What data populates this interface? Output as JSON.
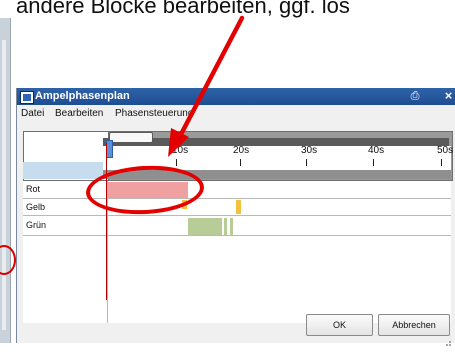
{
  "annotation": {
    "top_text": "andere Blöcke bearbeiten, ggf. lös"
  },
  "window": {
    "title": "Ampelphasenplan",
    "menu": [
      "Datei",
      "Bearbeiten",
      "Phasensteuerung"
    ]
  },
  "timeline": {
    "ticks": [
      "10s",
      "20s",
      "30s",
      "40s",
      "50s"
    ]
  },
  "rows": [
    "Rot",
    "Gelb",
    "Grün"
  ],
  "buttons": {
    "ok": "OK",
    "cancel": "Abbrechen"
  },
  "colors": {
    "red_phase": "#f0a0a0",
    "yellow_phase": "#f5c040",
    "green_phase": "#b8cc98",
    "annotation_red": "#e30000"
  },
  "icons": {
    "title": "window-app-icon",
    "print": "print-icon",
    "close": "close-icon"
  }
}
